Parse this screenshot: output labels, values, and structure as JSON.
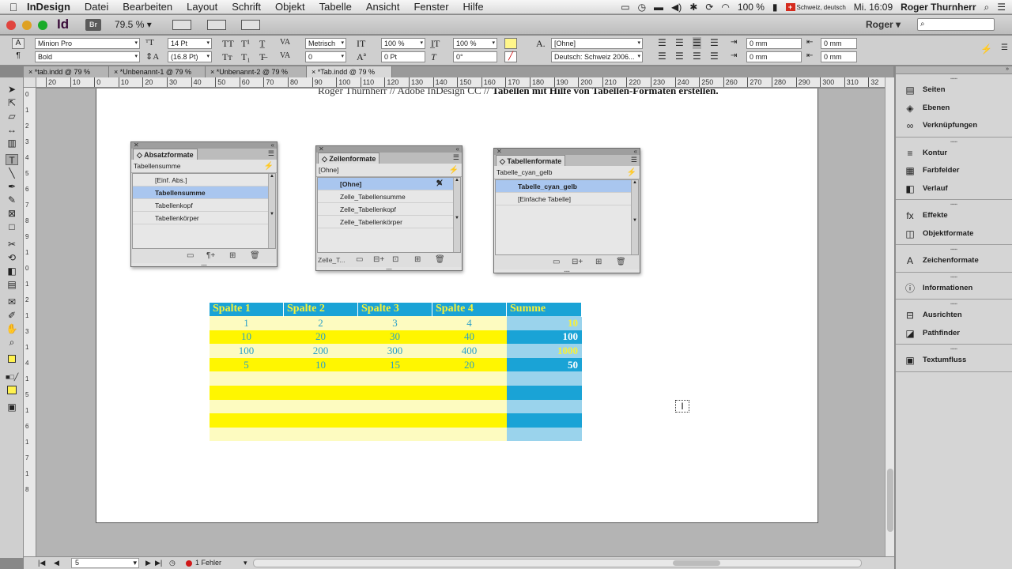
{
  "menubar": {
    "apple": "",
    "app_name": "InDesign",
    "menus": [
      "Datei",
      "Bearbeiten",
      "Layout",
      "Schrift",
      "Objekt",
      "Tabelle",
      "Ansicht",
      "Fenster",
      "Hilfe"
    ],
    "battery": "100 %",
    "input_source": "Schweiz, deutsch",
    "clock": "Mi. 16:09",
    "user": "Roger Thurnherr"
  },
  "appbar": {
    "logo": "Id",
    "bridge": "Br",
    "zoom": "79.5 %",
    "workspace_user": "Roger",
    "search_placeholder": ""
  },
  "control": {
    "font_family": "Minion Pro",
    "font_style": "Bold",
    "font_size": "14 Pt",
    "leading": "(16.8 Pt)",
    "kerning": "Metrisch",
    "tracking": "0",
    "vscale": "100 %",
    "hscale": "100 %",
    "baseline": "0 Pt",
    "skew": "0°",
    "char_style": "[Ohne]",
    "language": "Deutsch: Schweiz 2006...",
    "indent_left": "0 mm",
    "indent_right": "0 mm",
    "indent_first": "0 mm",
    "indent_last": "0 mm"
  },
  "tabs": [
    {
      "label": "*tab.indd @ 79 %"
    },
    {
      "label": "*Unbenannt-1 @ 79 %"
    },
    {
      "label": "*Unbenannt-2 @ 79 %"
    },
    {
      "label": "*Tab.indd @ 79 %"
    }
  ],
  "ruler_h": [
    "20",
    "10",
    "0",
    "10",
    "20",
    "30",
    "40",
    "50",
    "60",
    "70",
    "80",
    "90",
    "100",
    "110",
    "120",
    "130",
    "140",
    "150",
    "160",
    "170",
    "180",
    "190",
    "200",
    "210",
    "220",
    "230",
    "240",
    "250",
    "260",
    "270",
    "280",
    "290",
    "300",
    "310",
    "32"
  ],
  "ruler_v": [
    "0",
    "1",
    "2",
    "3",
    "4",
    "5",
    "6",
    "7",
    "8",
    "9",
    "1",
    "0",
    "1",
    "2",
    "1",
    "3",
    "1",
    "4",
    "1",
    "5",
    "1",
    "6",
    "1",
    "7",
    "1",
    "8"
  ],
  "page": {
    "header_plain": "Roger Thurnherr  //  Adobe InDesign CC  //  ",
    "header_bold": "Tabellen mit Hilfe von Tabellen-Formaten erstellen."
  },
  "panels": {
    "absatz": {
      "title": "Absatzformate",
      "current": "Tabellensumme",
      "items": [
        "[Einf. Abs.]",
        "Tabellensumme",
        "Tabellenkopf",
        "Tabellenkörper"
      ]
    },
    "zellen": {
      "title": "Zellenformate",
      "current": "[Ohne]",
      "items": [
        "[Ohne]",
        "Zelle_Tabellensumme",
        "Zelle_Tabellenkopf",
        "Zelle_Tabellenkörper"
      ],
      "footer_label": "Zelle_T..."
    },
    "tabellen": {
      "title": "Tabellenformate",
      "current": "Tabelle_cyan_gelb",
      "items": [
        "Tabelle_cyan_gelb",
        "[Einfache Tabelle]"
      ]
    }
  },
  "table": {
    "headers": [
      "Spalte 1",
      "Spalte 2",
      "Spalte 3",
      "Spalte 4",
      "Summe"
    ],
    "rows": [
      [
        "1",
        "2",
        "3",
        "4",
        "10"
      ],
      [
        "10",
        "20",
        "30",
        "40",
        "100"
      ],
      [
        "100",
        "200",
        "300",
        "400",
        "1000"
      ],
      [
        "5",
        "10",
        "15",
        "20",
        "50"
      ],
      [
        "",
        "",
        "",
        "",
        ""
      ],
      [
        "",
        "",
        "",
        "",
        ""
      ],
      [
        "",
        "",
        "",
        "",
        ""
      ],
      [
        "",
        "",
        "",
        "",
        ""
      ],
      [
        "",
        "",
        "",
        "",
        ""
      ]
    ]
  },
  "status": {
    "page": "5",
    "errors": "1 Fehler"
  },
  "dock": {
    "groups": [
      [
        {
          "icon": "▤",
          "label": "Seiten"
        },
        {
          "icon": "◈",
          "label": "Ebenen"
        },
        {
          "icon": "∞",
          "label": "Verknüpfungen"
        }
      ],
      [
        {
          "icon": "≡",
          "label": "Kontur"
        },
        {
          "icon": "▦",
          "label": "Farbfelder"
        },
        {
          "icon": "◧",
          "label": "Verlauf"
        }
      ],
      [
        {
          "icon": "fx",
          "label": "Effekte"
        },
        {
          "icon": "◫",
          "label": "Objektformate"
        }
      ],
      [
        {
          "icon": "A",
          "label": "Zeichenformate"
        }
      ],
      [
        {
          "icon": "ⓘ",
          "label": "Informationen"
        }
      ],
      [
        {
          "icon": "⊟",
          "label": "Ausrichten"
        },
        {
          "icon": "◪",
          "label": "Pathfinder"
        }
      ],
      [
        {
          "icon": "▣",
          "label": "Textumfluss"
        }
      ]
    ]
  }
}
